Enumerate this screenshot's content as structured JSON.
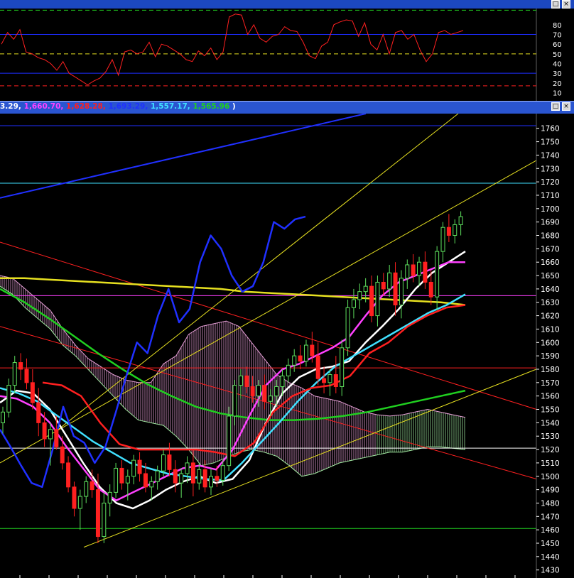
{
  "window_buttons": {
    "maximize_glyph": "□",
    "close_glyph": "×"
  },
  "title_values": [
    {
      "text": "3.29, ",
      "color": "#ffffff"
    },
    {
      "text": "1,660.70, ",
      "color": "#ff40ff"
    },
    {
      "text": "1,628.28, ",
      "color": "#ff2020"
    },
    {
      "text": "1,693.29, ",
      "color": "#2030ff"
    },
    {
      "text": "1,557.17, ",
      "color": "#40e0ff"
    },
    {
      "text": "1,565.96",
      "color": "#20d020"
    },
    {
      "text": " )",
      "color": "#ffffff"
    }
  ],
  "chart_data": [
    {
      "type": "line",
      "yaxis": {
        "ticks": [
          10,
          20,
          30,
          40,
          50,
          60,
          70,
          80
        ],
        "ylim": [
          3,
          96
        ]
      },
      "reference_lines": [
        {
          "value": 95,
          "color": "#20d020",
          "style": "dashed"
        },
        {
          "value": 70,
          "color": "#1c2cff",
          "style": "solid"
        },
        {
          "value": 50,
          "color": "#e6e020",
          "style": "dashed"
        },
        {
          "value": 30,
          "color": "#1c2cff",
          "style": "solid"
        },
        {
          "value": 17,
          "color": "#ff2020",
          "style": "dashed"
        }
      ],
      "series": [
        {
          "color": "#ff2020",
          "values": [
            60,
            72,
            65,
            75,
            52,
            50,
            46,
            44,
            40,
            33,
            42,
            30,
            26,
            22,
            18,
            22,
            25,
            32,
            44,
            28,
            52,
            54,
            50,
            52,
            62,
            47,
            60,
            58,
            54,
            50,
            44,
            42,
            53,
            48,
            56,
            44,
            52,
            88,
            91,
            90,
            70,
            80,
            66,
            62,
            68,
            70,
            78,
            74,
            73,
            62,
            48,
            45,
            58,
            62,
            80,
            83,
            85,
            84,
            68,
            82,
            60,
            54,
            70,
            50,
            72,
            74,
            65,
            70,
            54,
            42,
            50,
            72,
            74,
            70,
            72,
            74
          ]
        }
      ]
    },
    {
      "type": "candlestick",
      "yaxis": {
        "ticks": [
          1430,
          1440,
          1450,
          1460,
          1470,
          1480,
          1490,
          1500,
          1510,
          1520,
          1530,
          1540,
          1550,
          1560,
          1570,
          1580,
          1590,
          1600,
          1610,
          1620,
          1630,
          1640,
          1650,
          1660,
          1670,
          1680,
          1690,
          1700,
          1710,
          1720,
          1730,
          1740,
          1750,
          1760
        ],
        "ylim": [
          1424,
          1771
        ]
      },
      "reference_lines": [
        {
          "value": 1762,
          "color": "#2030ff"
        },
        {
          "value": 1719,
          "color": "#40e0ff"
        },
        {
          "value": 1635,
          "color": "#ff40ff"
        },
        {
          "value": 1581,
          "color": "#ff2020"
        },
        {
          "value": 1521,
          "color": "#ffffff"
        },
        {
          "value": 1461,
          "color": "#20d020"
        }
      ],
      "trend_lines": [
        {
          "color": "#2030ff",
          "x1": 0,
          "y1": 1708,
          "x2": 515,
          "y2": 1771,
          "width": 2
        },
        {
          "color": "#ff2020",
          "x1": 0,
          "y1": 1675,
          "x2": 755,
          "y2": 1550,
          "width": 1
        },
        {
          "color": "#ff2020",
          "x1": 0,
          "y1": 1612,
          "x2": 755,
          "y2": 1498,
          "width": 1
        },
        {
          "color": "#e6e020",
          "x1": 118,
          "y1": 1447,
          "x2": 755,
          "y2": 1580,
          "width": 1
        },
        {
          "color": "#e6e020",
          "x1": 0,
          "y1": 1510,
          "x2": 755,
          "y2": 1736,
          "width": 1
        },
        {
          "color": "#e6e020",
          "x1": 82,
          "y1": 1535,
          "x2": 645,
          "y2": 1771,
          "width": 1
        }
      ],
      "candles": [
        [
          1540,
          1552,
          1532,
          1548
        ],
        [
          1548,
          1573,
          1544,
          1568
        ],
        [
          1568,
          1590,
          1562,
          1585
        ],
        [
          1585,
          1592,
          1572,
          1580
        ],
        [
          1580,
          1588,
          1565,
          1570
        ],
        [
          1570,
          1580,
          1550,
          1555
        ],
        [
          1555,
          1566,
          1530,
          1540
        ],
        [
          1540,
          1548,
          1522,
          1528
        ],
        [
          1528,
          1540,
          1508,
          1535
        ],
        [
          1535,
          1545,
          1520,
          1522
        ],
        [
          1522,
          1530,
          1505,
          1510
        ],
        [
          1510,
          1515,
          1488,
          1492
        ],
        [
          1492,
          1496,
          1470,
          1476
        ],
        [
          1476,
          1490,
          1460,
          1485
        ],
        [
          1485,
          1500,
          1480,
          1496
        ],
        [
          1496,
          1505,
          1484,
          1490
        ],
        [
          1490,
          1502,
          1450,
          1455
        ],
        [
          1455,
          1488,
          1450,
          1480
        ],
        [
          1480,
          1494,
          1470,
          1488
        ],
        [
          1488,
          1510,
          1484,
          1506
        ],
        [
          1506,
          1512,
          1490,
          1495
        ],
        [
          1495,
          1505,
          1482,
          1500
        ],
        [
          1500,
          1516,
          1494,
          1512
        ],
        [
          1512,
          1518,
          1496,
          1502
        ],
        [
          1502,
          1510,
          1488,
          1492
        ],
        [
          1492,
          1500,
          1482,
          1496
        ],
        [
          1496,
          1508,
          1490,
          1504
        ],
        [
          1504,
          1520,
          1500,
          1516
        ],
        [
          1516,
          1525,
          1500,
          1505
        ],
        [
          1505,
          1512,
          1488,
          1495
        ],
        [
          1495,
          1506,
          1484,
          1502
        ],
        [
          1502,
          1515,
          1495,
          1510
        ],
        [
          1510,
          1520,
          1485,
          1495
        ],
        [
          1495,
          1510,
          1490,
          1505
        ],
        [
          1505,
          1512,
          1488,
          1492
        ],
        [
          1492,
          1506,
          1486,
          1500
        ],
        [
          1500,
          1508,
          1492,
          1497
        ],
        [
          1497,
          1512,
          1493,
          1508
        ],
        [
          1508,
          1552,
          1504,
          1545
        ],
        [
          1545,
          1572,
          1538,
          1568
        ],
        [
          1568,
          1580,
          1558,
          1575
        ],
        [
          1575,
          1582,
          1562,
          1567
        ],
        [
          1567,
          1575,
          1555,
          1560
        ],
        [
          1560,
          1572,
          1552,
          1568
        ],
        [
          1568,
          1576,
          1550,
          1556
        ],
        [
          1556,
          1565,
          1545,
          1560
        ],
        [
          1560,
          1572,
          1552,
          1567
        ],
        [
          1567,
          1580,
          1560,
          1575
        ],
        [
          1575,
          1588,
          1570,
          1583
        ],
        [
          1583,
          1595,
          1578,
          1590
        ],
        [
          1590,
          1598,
          1580,
          1586
        ],
        [
          1586,
          1602,
          1582,
          1598
        ],
        [
          1598,
          1608,
          1585,
          1590
        ],
        [
          1590,
          1600,
          1568,
          1573
        ],
        [
          1573,
          1582,
          1562,
          1570
        ],
        [
          1570,
          1580,
          1560,
          1576
        ],
        [
          1576,
          1590,
          1562,
          1567
        ],
        [
          1567,
          1602,
          1560,
          1596
        ],
        [
          1596,
          1632,
          1590,
          1626
        ],
        [
          1626,
          1640,
          1618,
          1632
        ],
        [
          1632,
          1644,
          1625,
          1638
        ],
        [
          1638,
          1648,
          1630,
          1642
        ],
        [
          1642,
          1650,
          1615,
          1620
        ],
        [
          1620,
          1650,
          1612,
          1645
        ],
        [
          1645,
          1652,
          1635,
          1640
        ],
        [
          1640,
          1658,
          1634,
          1652
        ],
        [
          1652,
          1660,
          1620,
          1628
        ],
        [
          1628,
          1654,
          1618,
          1648
        ],
        [
          1648,
          1662,
          1640,
          1658
        ],
        [
          1658,
          1666,
          1645,
          1650
        ],
        [
          1650,
          1664,
          1642,
          1660
        ],
        [
          1660,
          1668,
          1640,
          1645
        ],
        [
          1645,
          1654,
          1628,
          1634
        ],
        [
          1634,
          1672,
          1624,
          1668
        ],
        [
          1668,
          1690,
          1660,
          1686
        ],
        [
          1686,
          1696,
          1675,
          1680
        ],
        [
          1680,
          1692,
          1674,
          1688
        ],
        [
          1688,
          1698,
          1680,
          1694
        ]
      ],
      "series": [
        {
          "color": "#e6e020",
          "values": [
            1648,
            1648,
            1647,
            1646,
            1645,
            1644,
            1643,
            1642,
            1641,
            1640,
            1638,
            1637,
            1636,
            1635,
            1634,
            1633,
            1632,
            1631,
            1630,
            1628
          ]
        },
        {
          "color": "#20d020",
          "values": [
            1640,
            1630,
            1618,
            1605,
            1592,
            1580,
            1569,
            1560,
            1552,
            1547,
            1544,
            1542,
            1542,
            1543,
            1545,
            1548,
            1552,
            1556,
            1560,
            1564
          ]
        },
        {
          "color": "#ffffff",
          "values": [
            1555,
            1564,
            1562,
            1550,
            1530,
            1510,
            1492,
            1480,
            1476,
            1482,
            1490,
            1496,
            1500,
            1495,
            1498,
            1512,
            1540,
            1562,
            1574,
            1580,
            1582,
            1586,
            1600,
            1612,
            1625,
            1640,
            1652,
            1660,
            1668
          ]
        },
        {
          "color": "#ff40ff",
          "values": [
            1560,
            1558,
            1552,
            1540,
            1522,
            1506,
            1490,
            1482,
            1488,
            1494,
            1500,
            1506,
            1508,
            1505,
            1520,
            1545,
            1568,
            1580,
            1584,
            1590,
            1596,
            1604,
            1620,
            1635,
            1645,
            1650,
            1655,
            1660,
            1660
          ]
        },
        {
          "color": "#40e0ff",
          "values": [
            1566,
            1562,
            1556,
            1546,
            1536,
            1526,
            1518,
            1510,
            1506,
            1502,
            1500,
            1498,
            1497,
            1510,
            1525,
            1540,
            1556,
            1570,
            1582,
            1590,
            1598,
            1606,
            1614,
            1622,
            1628,
            1636
          ]
        },
        {
          "color": "#ff2020",
          "values": [
            1570,
            1568,
            1560,
            1540,
            1524,
            1520,
            1520,
            1520,
            1520,
            1518,
            1515,
            1525,
            1548,
            1560,
            1566,
            1568,
            1575,
            1592,
            1600,
            1612,
            1620,
            1626,
            1628
          ]
        },
        {
          "color": "#2030ff",
          "values": [
            1535,
            1522,
            1508,
            1495,
            1492,
            1520,
            1552,
            1530,
            1525,
            1510,
            1522,
            1548,
            1575,
            1600,
            1592,
            1620,
            1640,
            1615,
            1625,
            1660,
            1680,
            1670,
            1650,
            1638,
            1642,
            1660,
            1690,
            1685,
            1692,
            1694
          ]
        }
      ]
    }
  ]
}
